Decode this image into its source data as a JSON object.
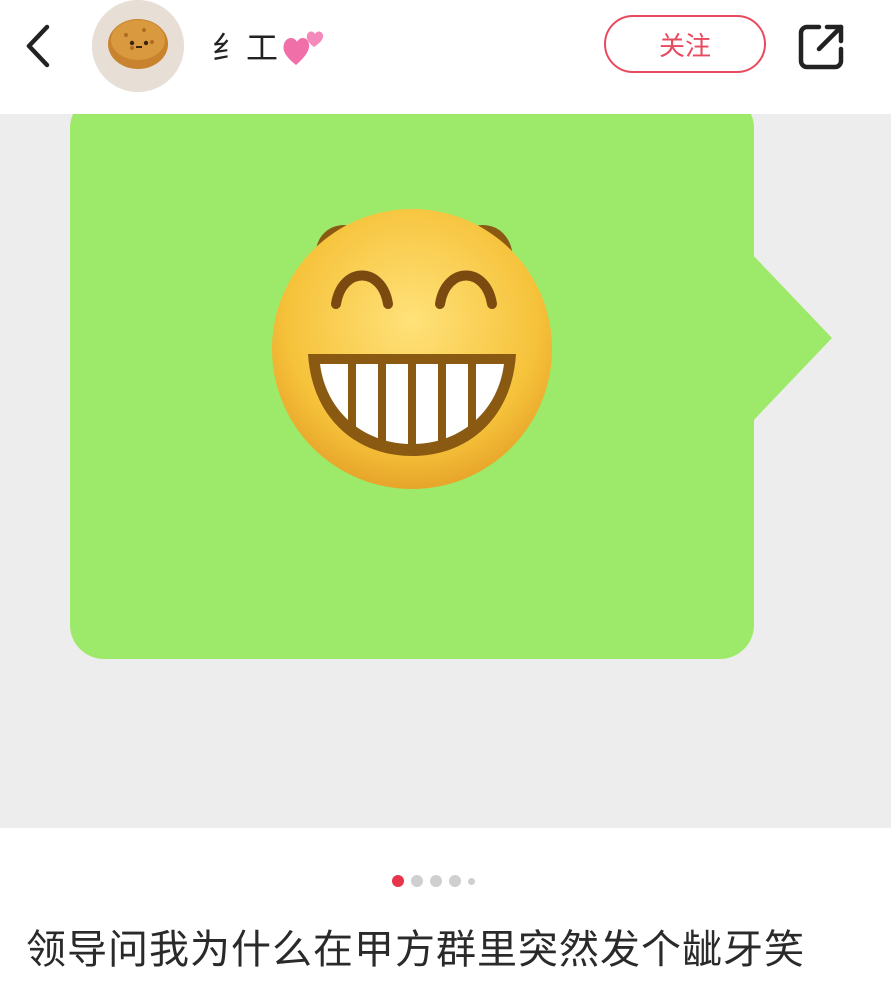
{
  "header": {
    "back_icon": "chevron-left-icon",
    "avatar_icon": "fried-bun-avatar",
    "username": "纟工",
    "username_emoji": "two-hearts-icon",
    "follow_label": "关注",
    "share_icon": "share-external-icon"
  },
  "post": {
    "image": {
      "description_icon": "grinning-squinting-face-emoji",
      "bubble_color": "#9dea6a",
      "background_color": "#ededed"
    },
    "pager": {
      "total": 5,
      "active_index": 0
    },
    "caption": "领导问我为什么在甲方群里突然发个龇牙笑"
  },
  "colors": {
    "accent": "#e84a5f",
    "active_dot": "#e8354b",
    "text": "#2a2a2a"
  }
}
